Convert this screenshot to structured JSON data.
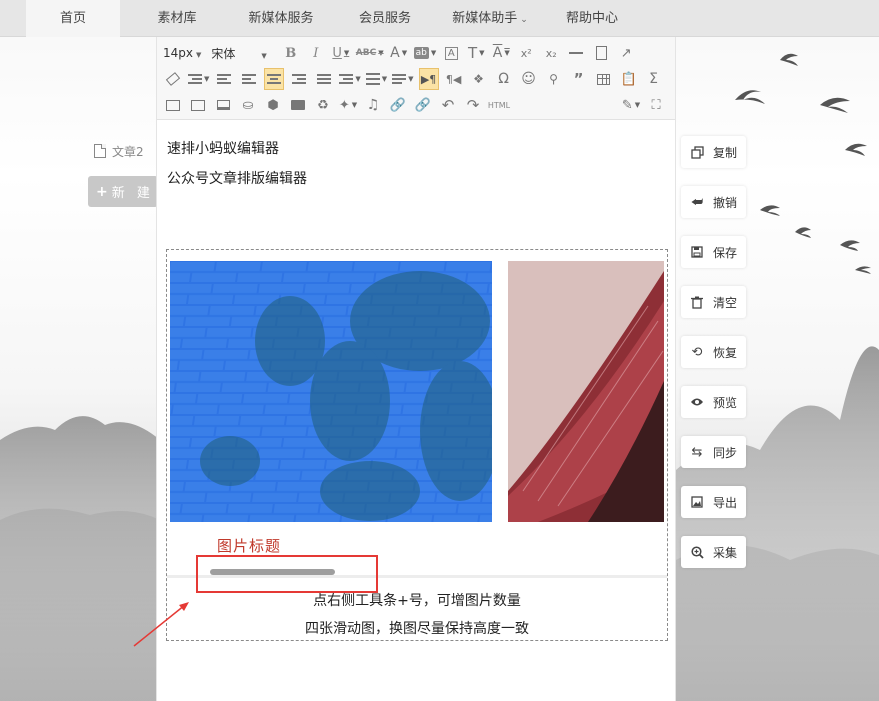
{
  "nav": {
    "items": [
      {
        "label": "首页",
        "active": true
      },
      {
        "label": "素材库"
      },
      {
        "label": "新媒体服务"
      },
      {
        "label": "会员服务"
      },
      {
        "label": "新媒体助手",
        "has_dropdown": true
      },
      {
        "label": "帮助中心"
      }
    ]
  },
  "sidebar": {
    "doc_label": "文章2",
    "new_button_label": "新 建"
  },
  "toolbar": {
    "font_size": "14px",
    "font_family": "宋体",
    "html_label": "HTML"
  },
  "content": {
    "line1": "速排小蚂蚁编辑器",
    "line2": "公众号文章排版编辑器",
    "caption": "图片标题",
    "hint1": "点右侧工具条+号，可增图片数量",
    "hint2": "四张滑动图，换图尽量保持高度一致"
  },
  "actions": [
    {
      "label": "复制",
      "icon": "copy-icon"
    },
    {
      "label": "撤销",
      "icon": "undo-icon"
    },
    {
      "label": "保存",
      "icon": "save-icon"
    },
    {
      "label": "清空",
      "icon": "trash-icon"
    },
    {
      "label": "恢复",
      "icon": "restore-icon"
    },
    {
      "label": "预览",
      "icon": "eye-icon"
    },
    {
      "label": "同步",
      "icon": "sync-icon"
    },
    {
      "label": "导出",
      "icon": "export-image-icon"
    },
    {
      "label": "采集",
      "icon": "collect-search-icon"
    }
  ],
  "colors": {
    "nav_bg": "#e6e6e6",
    "highlight_button": "#fbe3a5",
    "caption_red": "#c0392b",
    "annotation_red": "#e53935",
    "image_blue": "#2a6fe0"
  }
}
